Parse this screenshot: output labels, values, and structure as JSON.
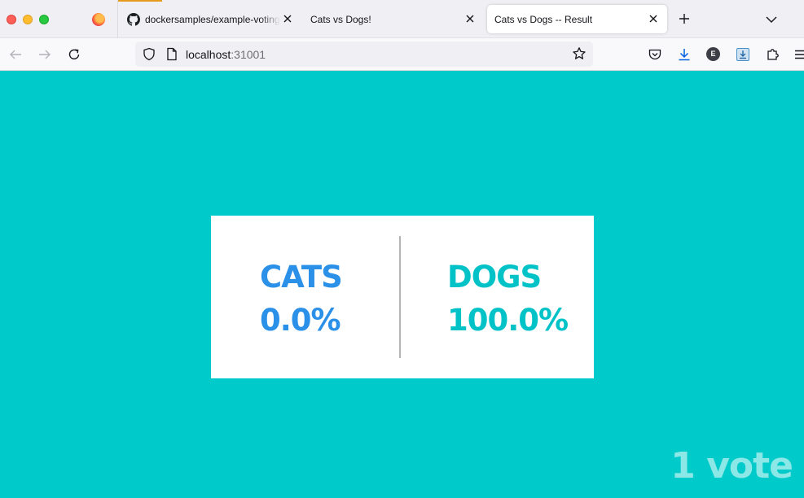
{
  "browser": {
    "tabs": [
      {
        "title": "dockersamples/example-voting-app",
        "favicon": "github-icon",
        "active": false
      },
      {
        "title": "Cats vs Dogs!",
        "favicon": "",
        "active": false
      },
      {
        "title": "Cats vs Dogs -- Result",
        "favicon": "",
        "active": true
      }
    ],
    "url": {
      "host": "localhost",
      "port": ":31001"
    },
    "extension_letter": "E",
    "colors": {
      "tab_loading": "#e89a1c",
      "toolbar_accent": "#0060df"
    }
  },
  "result": {
    "option_a": {
      "name": "CATS",
      "percent": "0.0%",
      "color": "#2a90e8"
    },
    "option_b": {
      "name": "DOGS",
      "percent": "100.0%",
      "color": "#00c2c7"
    },
    "votes": "1 vote"
  },
  "page": {
    "background": "#00cbca"
  }
}
